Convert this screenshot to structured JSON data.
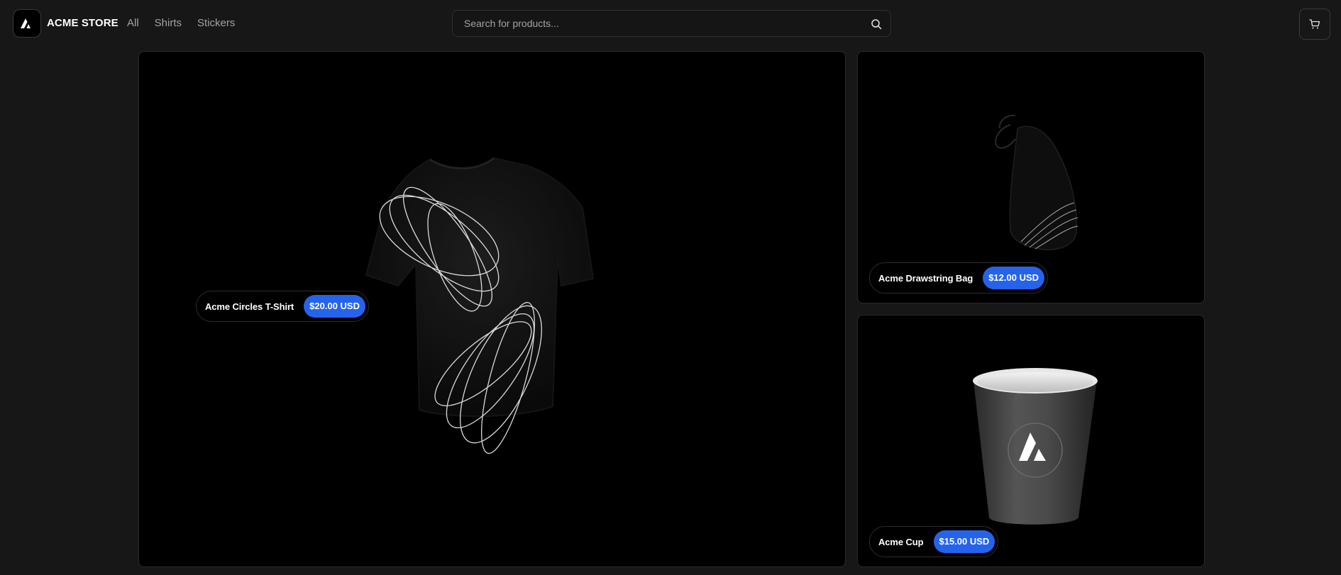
{
  "header": {
    "brand": "ACME STORE",
    "nav": [
      {
        "label": "All"
      },
      {
        "label": "Shirts"
      },
      {
        "label": "Stickers"
      }
    ],
    "search": {
      "placeholder": "Search for products...",
      "value": ""
    },
    "icons": {
      "logo": "acme-triangle-logo",
      "search": "search-icon",
      "cart": "cart-icon"
    }
  },
  "products": [
    {
      "title": "Acme Circles T-Shirt",
      "price": "$20.00 USD"
    },
    {
      "title": "Acme Drawstring Bag",
      "price": "$12.00 USD"
    },
    {
      "title": "Acme Cup",
      "price": "$15.00 USD"
    }
  ],
  "colors": {
    "background": "#171717",
    "tile": "#000000",
    "accent": "#2563eb"
  }
}
